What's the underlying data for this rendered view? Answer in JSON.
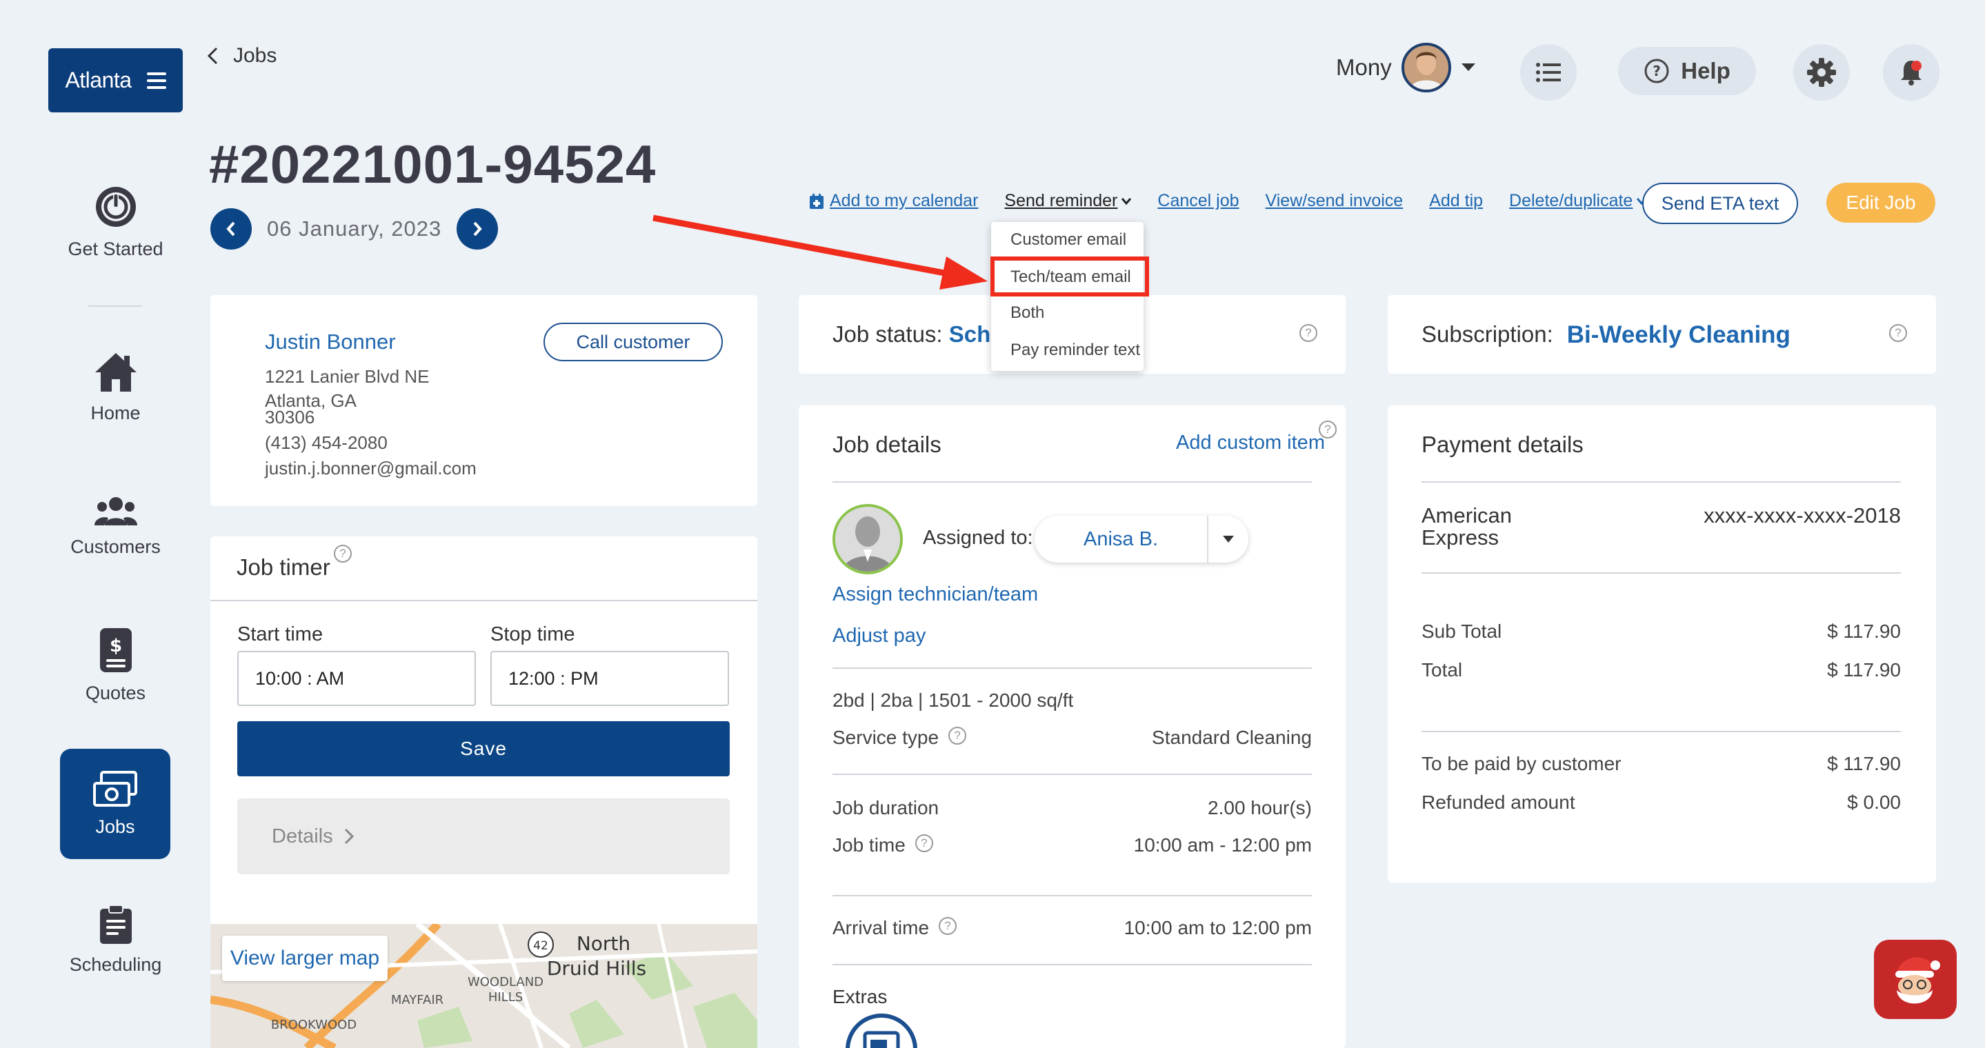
{
  "brand": {
    "label": "Atlanta"
  },
  "nav": {
    "get_started": "Get Started",
    "home": "Home",
    "customers": "Customers",
    "quotes": "Quotes",
    "jobs": "Jobs",
    "scheduling": "Scheduling"
  },
  "header": {
    "back_label": "Jobs",
    "user_name": "Mony",
    "help_label": "Help"
  },
  "job": {
    "id": "#20221001-94524",
    "date": "06 January, 2023"
  },
  "actions": {
    "add_calendar": "Add to my calendar",
    "send_reminder": "Send reminder",
    "cancel_job": "Cancel job",
    "view_invoice": "View/send invoice",
    "add_tip": "Add tip",
    "delete_duplicate": "Delete/duplicate",
    "send_eta": "Send ETA text",
    "edit_job": "Edit Job"
  },
  "reminder_menu": {
    "items": [
      "Customer email",
      "Tech/team email",
      "Both",
      "Pay reminder text"
    ],
    "highlighted": "Tech/team email"
  },
  "customer": {
    "name": "Justin Bonner",
    "call_label": "Call customer",
    "address1": "1221 Lanier Blvd NE",
    "address2": "Atlanta, GA",
    "zip": "30306",
    "phone": "(413) 454-2080",
    "email": "justin.j.bonner@gmail.com"
  },
  "timer": {
    "title": "Job timer",
    "start_label": "Start time",
    "stop_label": "Stop time",
    "start_value": "10:00 : AM",
    "stop_value": "12:00 : PM",
    "save_label": "Save",
    "details_label": "Details"
  },
  "map": {
    "view_larger": "View larger map",
    "labels": {
      "north": "North",
      "druid": "Druid Hills",
      "woodland": "WOODLAND",
      "hills": "HILLS",
      "mayfair": "MAYFAIR",
      "brookwood": "BROOKWOOD",
      "route": "42"
    }
  },
  "status": {
    "label": "Job status:",
    "value": "Sched"
  },
  "job_details": {
    "title": "Job details",
    "add_custom": "Add custom item",
    "assigned_label": "Assigned to:",
    "assigned_value": "Anisa B.",
    "assign_link": "Assign technician/team",
    "adjust_pay": "Adjust pay",
    "property": "2bd | 2ba | 1501 - 2000 sq/ft",
    "service_type_label": "Service type",
    "service_type_value": "Standard Cleaning",
    "duration_label": "Job duration",
    "duration_value": "2.00 hour(s)",
    "job_time_label": "Job time",
    "job_time_value": "10:00 am - 12:00 pm",
    "arrival_label": "Arrival time",
    "arrival_value": "10:00 am to 12:00 pm",
    "extras_label": "Extras"
  },
  "subscription": {
    "label": "Subscription:",
    "value": "Bi-Weekly Cleaning"
  },
  "payment": {
    "title": "Payment details",
    "card_brand_line1": "American",
    "card_brand_line2": "Express",
    "card_number": "xxxx-xxxx-xxxx-2018",
    "subtotal_label": "Sub Total",
    "subtotal_value": "$ 117.90",
    "total_label": "Total",
    "total_value": "$ 117.90",
    "to_pay_label": "To be paid by customer",
    "to_pay_value": "$ 117.90",
    "refunded_label": "Refunded amount",
    "refunded_value": "$ 0.00"
  },
  "colors": {
    "primary": "#0b4585",
    "link": "#1f68b0",
    "accent": "#f8b84e",
    "highlight": "#f02c1c"
  }
}
